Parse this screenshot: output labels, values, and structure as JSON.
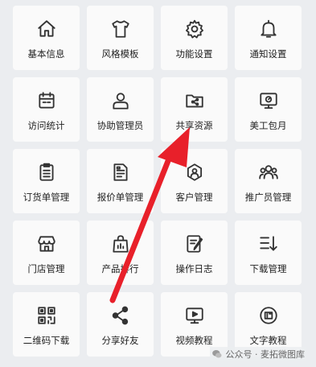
{
  "tiles": [
    {
      "label": "基本信息",
      "icon": "home-icon"
    },
    {
      "label": "风格模板",
      "icon": "shirt-icon"
    },
    {
      "label": "功能设置",
      "icon": "gear-icon"
    },
    {
      "label": "通知设置",
      "icon": "bell-icon"
    },
    {
      "label": "访问统计",
      "icon": "calendar-icon"
    },
    {
      "label": "协助管理员",
      "icon": "user-icon"
    },
    {
      "label": "共享资源",
      "icon": "share-folder-icon"
    },
    {
      "label": "美工包月",
      "icon": "monitor-icon"
    },
    {
      "label": "订货单管理",
      "icon": "list-icon"
    },
    {
      "label": "报价单管理",
      "icon": "document-icon"
    },
    {
      "label": "客户管理",
      "icon": "customer-icon"
    },
    {
      "label": "推广员管理",
      "icon": "group-icon"
    },
    {
      "label": "门店管理",
      "icon": "store-icon"
    },
    {
      "label": "产品排行",
      "icon": "bag-icon"
    },
    {
      "label": "操作日志",
      "icon": "notebook-icon"
    },
    {
      "label": "下载管理",
      "icon": "download-list-icon"
    },
    {
      "label": "二维码下载",
      "icon": "qrcode-icon"
    },
    {
      "label": "分享好友",
      "icon": "share-icon"
    },
    {
      "label": "视频教程",
      "icon": "video-icon"
    },
    {
      "label": "文字教程",
      "icon": "text-icon"
    }
  ],
  "watermark": {
    "text": "公众号 · 麦拓微图库"
  },
  "colors": {
    "arrow": "#e8202a",
    "icon": "#333333",
    "tile": "#fafafa",
    "background": "#ebedf0"
  }
}
